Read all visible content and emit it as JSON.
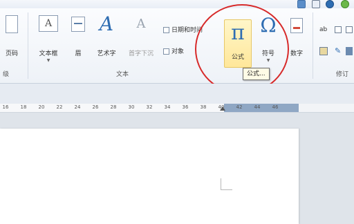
{
  "ribbon": {
    "tools": {
      "page_number": "页码",
      "textbox": "文本框",
      "header_footer": "眉",
      "wordart": "艺术字",
      "first_drop": "首字下沉",
      "formula": "公式",
      "symbol": "符号",
      "number": "数字"
    },
    "small_items": {
      "datetime": "日期和时间",
      "object": "对象"
    },
    "groups": {
      "text": "文本",
      "left_partial": "级",
      "right_partial": "修订"
    },
    "tooltip": "公式..."
  },
  "glyphs": {
    "pi": "π",
    "omega": "Ω",
    "wordart": "A",
    "textbox": "A",
    "first_drop": "A"
  },
  "ruler": {
    "ticks": [
      "16",
      "18",
      "20",
      "22",
      "24",
      "26",
      "28",
      "30",
      "32",
      "34",
      "36",
      "38",
      "40",
      "42",
      "44",
      "46"
    ]
  },
  "colors": {
    "accent_blue": "#2e6db2",
    "highlight": "#ffe79a",
    "annotation_red": "#d72a2a"
  }
}
